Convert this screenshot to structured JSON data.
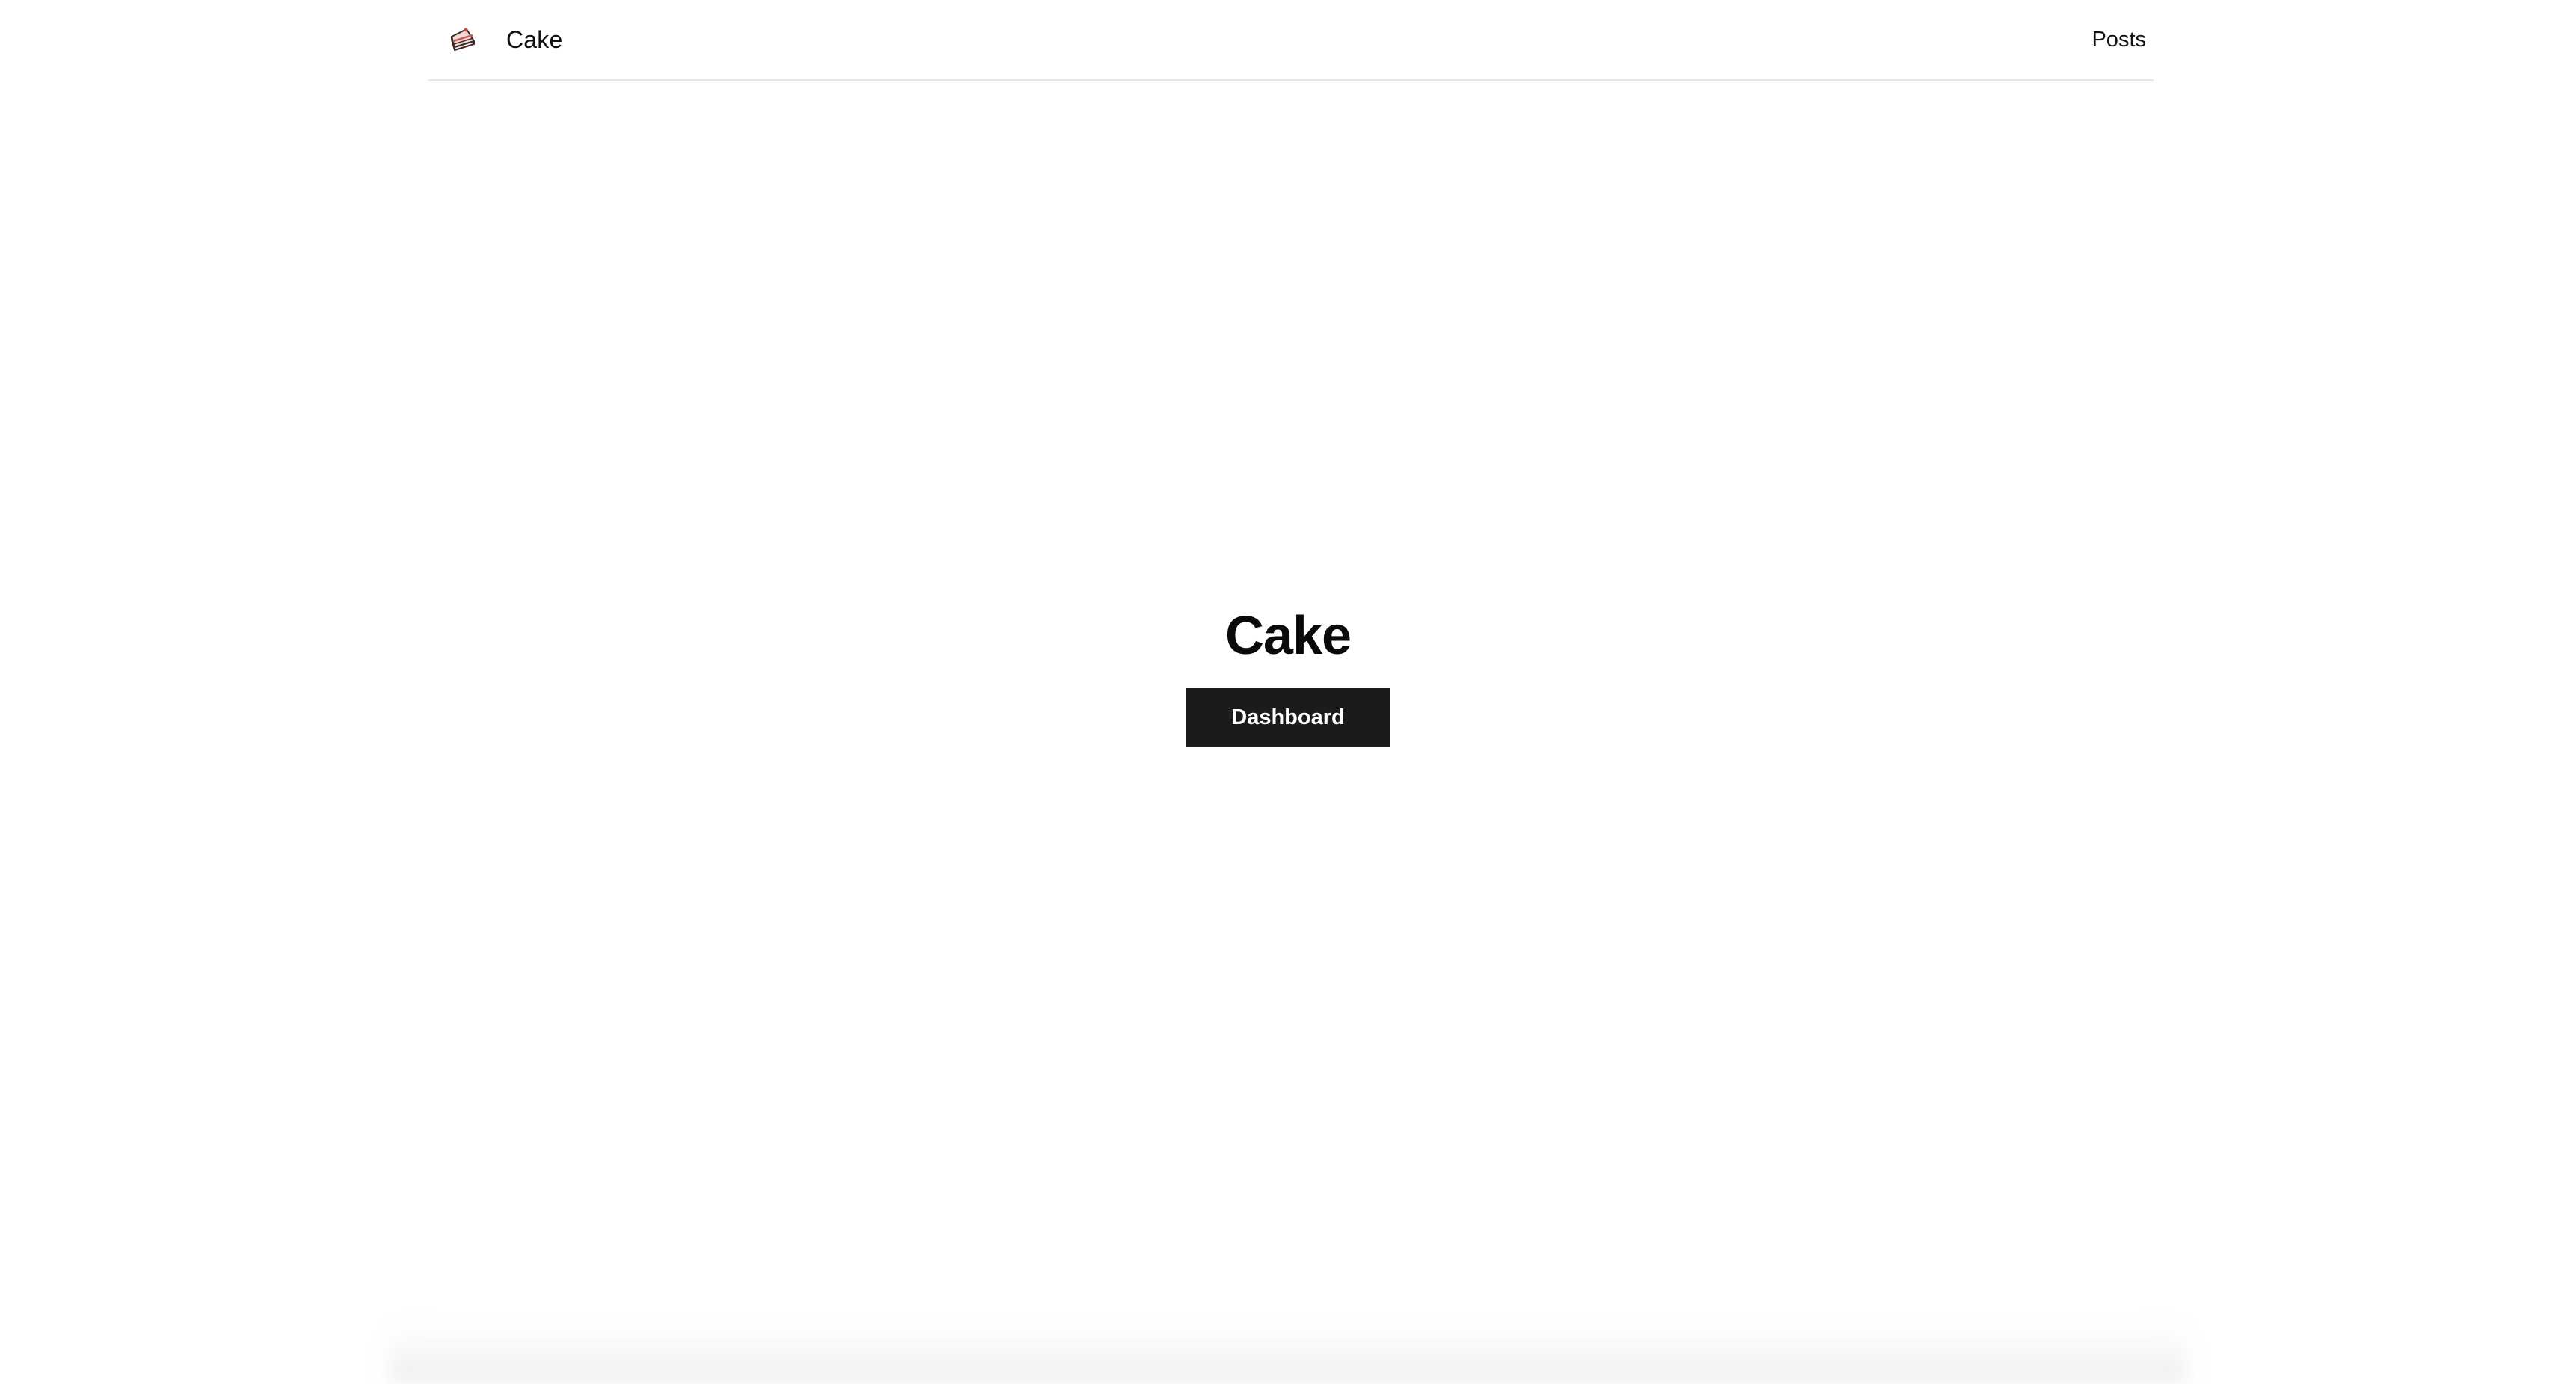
{
  "navbar": {
    "brand": {
      "icon": "cake-slice-icon",
      "name": "Cake"
    },
    "links": [
      {
        "label": "Posts"
      }
    ]
  },
  "hero": {
    "title": "Cake",
    "button_label": "Dashboard"
  },
  "colors": {
    "background": "#ffffff",
    "text": "#111111",
    "button_bg": "#1b1b1b",
    "button_text": "#ffffff",
    "divider": "#e6e6e6"
  }
}
